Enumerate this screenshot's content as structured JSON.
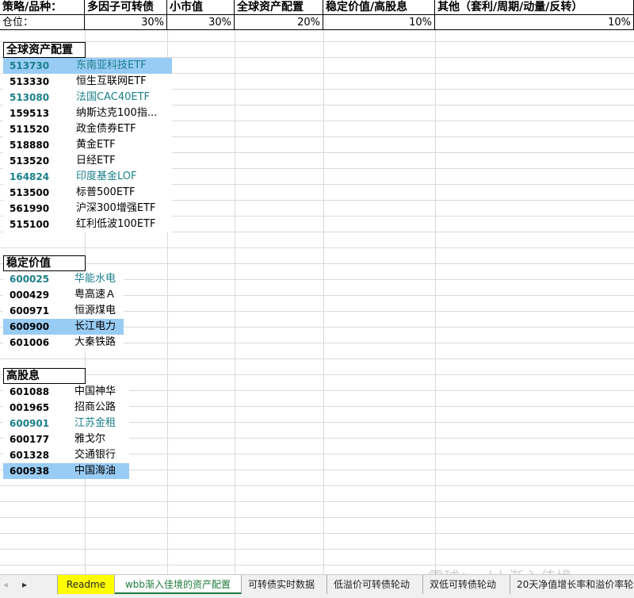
{
  "header": {
    "row1": [
      "策略/品种：",
      "多因子可转债",
      "小市值",
      "全球资产配置",
      "稳定价值/高股息",
      "其他（套利/周期/动量/反转）"
    ],
    "row2_label": "仓位：",
    "row2": [
      "30%",
      "30%",
      "20%",
      "10%",
      "10%"
    ]
  },
  "sections": [
    {
      "title": "全球资产配置",
      "items": [
        {
          "code": "513730",
          "name": "东南亚科技ETF",
          "teal": true,
          "sel": true
        },
        {
          "code": "513330",
          "name": "恒生互联网ETF"
        },
        {
          "code": "513080",
          "name": "法国CAC40ETF",
          "teal": true
        },
        {
          "code": "159513",
          "name": "纳斯达克100指..."
        },
        {
          "code": "511520",
          "name": "政金债券ETF"
        },
        {
          "code": "518880",
          "name": "黄金ETF"
        },
        {
          "code": "513520",
          "name": "日经ETF"
        },
        {
          "code": "164824",
          "name": "印度基金LOF",
          "teal": true
        },
        {
          "code": "513500",
          "name": "标普500ETF"
        },
        {
          "code": "561990",
          "name": "沪深300增强ETF"
        },
        {
          "code": "515100",
          "name": "红利低波100ETF"
        }
      ]
    },
    {
      "title": "稳定价值",
      "items": [
        {
          "code": "600025",
          "name": "华能水电",
          "teal": true
        },
        {
          "code": "000429",
          "name": "粤高速Ａ"
        },
        {
          "code": "600971",
          "name": "恒源煤电"
        },
        {
          "code": "600900",
          "name": "长江电力",
          "sel": true
        },
        {
          "code": "601006",
          "name": "大秦铁路"
        }
      ]
    },
    {
      "title": "高股息",
      "items": [
        {
          "code": "601088",
          "name": "中国神华"
        },
        {
          "code": "001965",
          "name": "招商公路"
        },
        {
          "code": "600901",
          "name": "江苏金租",
          "teal": true
        },
        {
          "code": "600177",
          "name": "雅戈尔"
        },
        {
          "code": "601328",
          "name": "交通银行"
        },
        {
          "code": "600938",
          "name": "中国海油",
          "sel": true
        }
      ]
    }
  ],
  "tabs": [
    "Readme",
    "wbb渐入佳境的资产配置",
    "可转债实时数据",
    "低溢价可转债轮动",
    "双低可转债轮动",
    "20天净值增长率和溢价率轮"
  ],
  "watermark": "雪球：wbb渐入佳境"
}
